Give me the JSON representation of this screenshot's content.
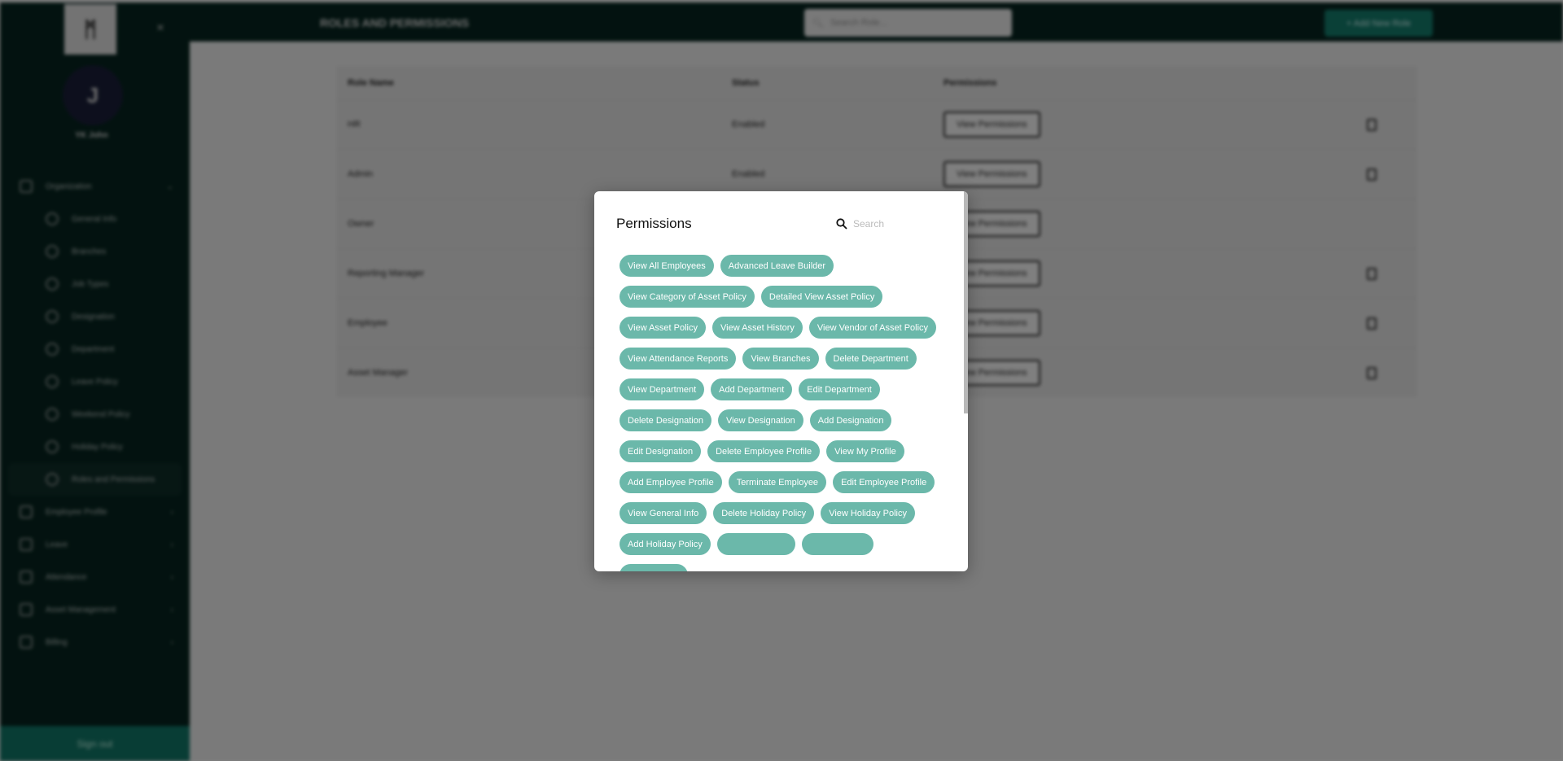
{
  "sidebar": {
    "logo": "ᛗ",
    "avatar_initial": "J",
    "user_name": "YK John",
    "items": [
      {
        "label": "Organization",
        "sub": false,
        "chevron": "⌄"
      },
      {
        "label": "General Info",
        "sub": true
      },
      {
        "label": "Branches",
        "sub": true
      },
      {
        "label": "Job Types",
        "sub": true
      },
      {
        "label": "Designation",
        "sub": true
      },
      {
        "label": "Department",
        "sub": true
      },
      {
        "label": "Leave Policy",
        "sub": true
      },
      {
        "label": "Weekend Policy",
        "sub": true
      },
      {
        "label": "Holiday Policy",
        "sub": true
      },
      {
        "label": "Roles and Permissions",
        "sub": true,
        "active": true
      },
      {
        "label": "Employee Profile",
        "sub": false,
        "chevron": "›"
      },
      {
        "label": "Leave",
        "sub": false,
        "chevron": "›"
      },
      {
        "label": "Attendance",
        "sub": false,
        "chevron": "›"
      },
      {
        "label": "Asset Management",
        "sub": false,
        "chevron": "›"
      },
      {
        "label": "Billing",
        "sub": false,
        "chevron": "›"
      }
    ],
    "signout": "Sign out"
  },
  "header": {
    "title": "ROLES AND PERMISSIONS",
    "search_placeholder": "Search Role...",
    "add_button": "+ Add New Role"
  },
  "table": {
    "columns": [
      "Role Name",
      "Status",
      "Permissions"
    ],
    "view_label": "View Permissions",
    "rows": [
      {
        "name": "HR",
        "status": "Enabled",
        "copy": true
      },
      {
        "name": "Admin",
        "status": "Enabled",
        "copy": true
      },
      {
        "name": "Owner",
        "status": "",
        "copy": false
      },
      {
        "name": "Reporting Manager",
        "status": "",
        "copy": true
      },
      {
        "name": "Employee",
        "status": "",
        "copy": true
      },
      {
        "name": "Asset Manager",
        "status": "",
        "copy": true
      }
    ]
  },
  "modal": {
    "title": "Permissions",
    "search_placeholder": "Search",
    "permissions": [
      "View All Employees",
      "Advanced Leave Builder",
      "View Category of Asset Policy",
      "Detailed View Asset Policy",
      "View Asset Policy",
      "View Asset History",
      "View Vendor of Asset Policy",
      "View Attendance Reports",
      "View Branches",
      "Delete Department",
      "View Department",
      "Add Department",
      "Edit Department",
      "Delete Designation",
      "View Designation",
      "Add Designation",
      "Edit Designation",
      "Delete Employee Profile",
      "View My Profile",
      "Add Employee Profile",
      "Terminate Employee",
      "Edit Employee Profile",
      "View General Info",
      "Delete Holiday Policy",
      "View Holiday Policy",
      "Add Holiday Policy"
    ]
  },
  "colors": {
    "sidebar": "#062520",
    "accent": "#14806f",
    "chip": "#6bb8aa"
  }
}
